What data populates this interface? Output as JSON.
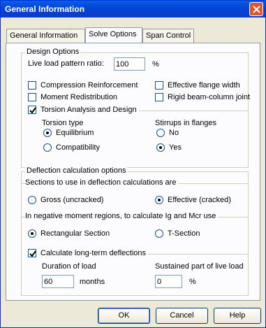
{
  "window": {
    "title": "General Information"
  },
  "tabs": [
    {
      "label": "General Information"
    },
    {
      "label": "Solve Options"
    },
    {
      "label": "Span Control"
    }
  ],
  "design_options": {
    "legend": "Design Options",
    "live_load_label": "Live load pattern ratio:",
    "live_load_value": "100",
    "live_load_unit": "%",
    "checkboxes": [
      {
        "label": "Compression Reinforcement",
        "checked": false
      },
      {
        "label": "Moment Redistribution",
        "checked": false
      },
      {
        "label": "Effective flange width",
        "checked": false
      },
      {
        "label": "Rigid beam-column joint",
        "checked": false
      }
    ],
    "torsion": {
      "label": "Torsion Analysis and Design",
      "checked": true,
      "type_label": "Torsion type",
      "type_options": [
        {
          "label": "Equilibrium",
          "selected": true
        },
        {
          "label": "Compatibility",
          "selected": false
        }
      ],
      "stirrups_label": "Stirrups in flanges",
      "stirrups_options": [
        {
          "label": "No",
          "selected": false
        },
        {
          "label": "Yes",
          "selected": true
        }
      ]
    }
  },
  "deflection": {
    "legend": "Deflection calculation options",
    "sections_label": "Sections to use in deflection calculations are",
    "sections_options": [
      {
        "label": "Gross (uncracked)",
        "selected": false
      },
      {
        "label": "Effective (cracked)",
        "selected": true
      }
    ],
    "negative_label": "In negative moment regions, to calculate Ig and Mcr use",
    "negative_options": [
      {
        "label": "Rectangular Section",
        "selected": true
      },
      {
        "label": "T-Section",
        "selected": false
      }
    ],
    "longterm": {
      "label": "Calculate long-term deflections",
      "checked": true,
      "duration_label": "Duration of load",
      "duration_value": "60",
      "duration_unit": "months",
      "sustained_label": "Sustained part of live load",
      "sustained_value": "0",
      "sustained_unit": "%"
    }
  },
  "buttons": {
    "ok": "OK",
    "cancel": "Cancel",
    "help": "Help"
  },
  "colors": {
    "titlebar": "#0346d8",
    "dialog_bg": "#ece9d8",
    "panel_bg": "#fcfcfe",
    "close_button": "#d9572f"
  }
}
